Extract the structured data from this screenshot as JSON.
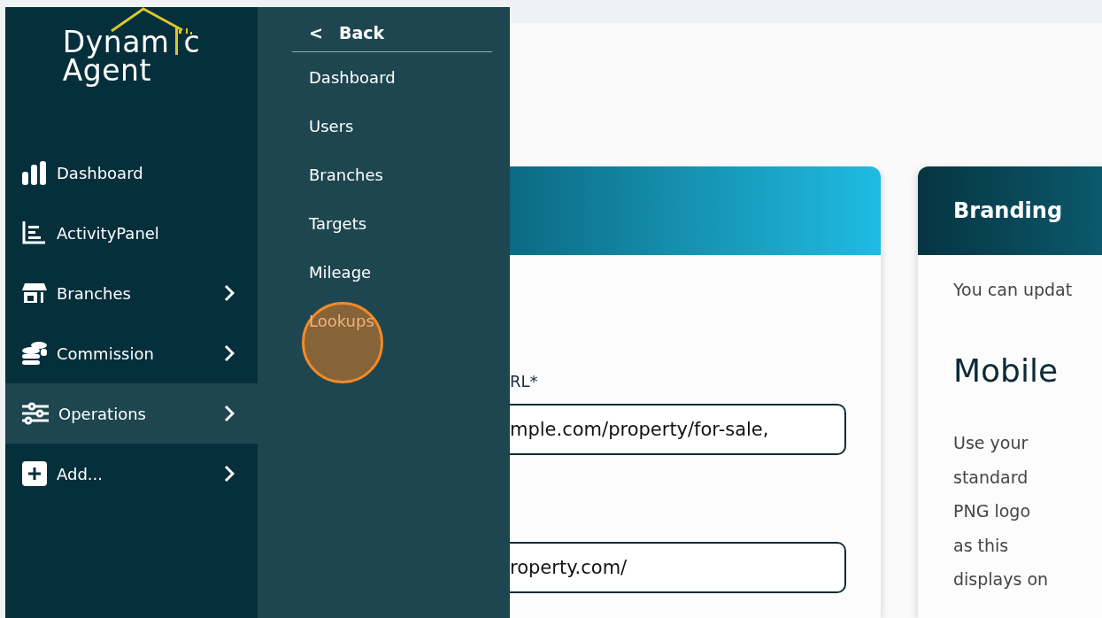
{
  "logo": {
    "word1_start": "Dynam",
    "word1_end": "c",
    "word2": "Agent"
  },
  "sidebar": {
    "items": [
      {
        "label": "Dashboard",
        "kind": "bars",
        "has_children": false,
        "selected": false
      },
      {
        "label": "ActivityPanel",
        "kind": "list",
        "has_children": false,
        "selected": false
      },
      {
        "label": "Branches",
        "kind": "store",
        "has_children": true,
        "selected": false
      },
      {
        "label": "Commission",
        "kind": "coins",
        "has_children": true,
        "selected": false
      },
      {
        "label": "Operations",
        "kind": "sliders",
        "has_children": true,
        "selected": true
      },
      {
        "label": "Add...",
        "kind": "plus",
        "has_children": true,
        "selected": false
      }
    ]
  },
  "submenu": {
    "back": {
      "icon": "<",
      "label": "Back"
    },
    "items": [
      {
        "label": "Dashboard",
        "selected": false
      },
      {
        "label": "Users",
        "selected": false
      },
      {
        "label": "Branches",
        "selected": false
      },
      {
        "label": "Targets",
        "selected": false
      },
      {
        "label": "Mileage",
        "selected": false
      },
      {
        "label": "Lookups",
        "selected": true
      }
    ]
  },
  "settings_card": {
    "fields": [
      {
        "label": "RL*",
        "value": "mple.com/property/for-sale,"
      },
      {
        "value": "roperty.com/"
      }
    ]
  },
  "branding_card": {
    "title": "Branding",
    "intro": "You can updat",
    "section_title": "Mobile",
    "section_text": "Use your standard PNG logo as this displays on"
  }
}
